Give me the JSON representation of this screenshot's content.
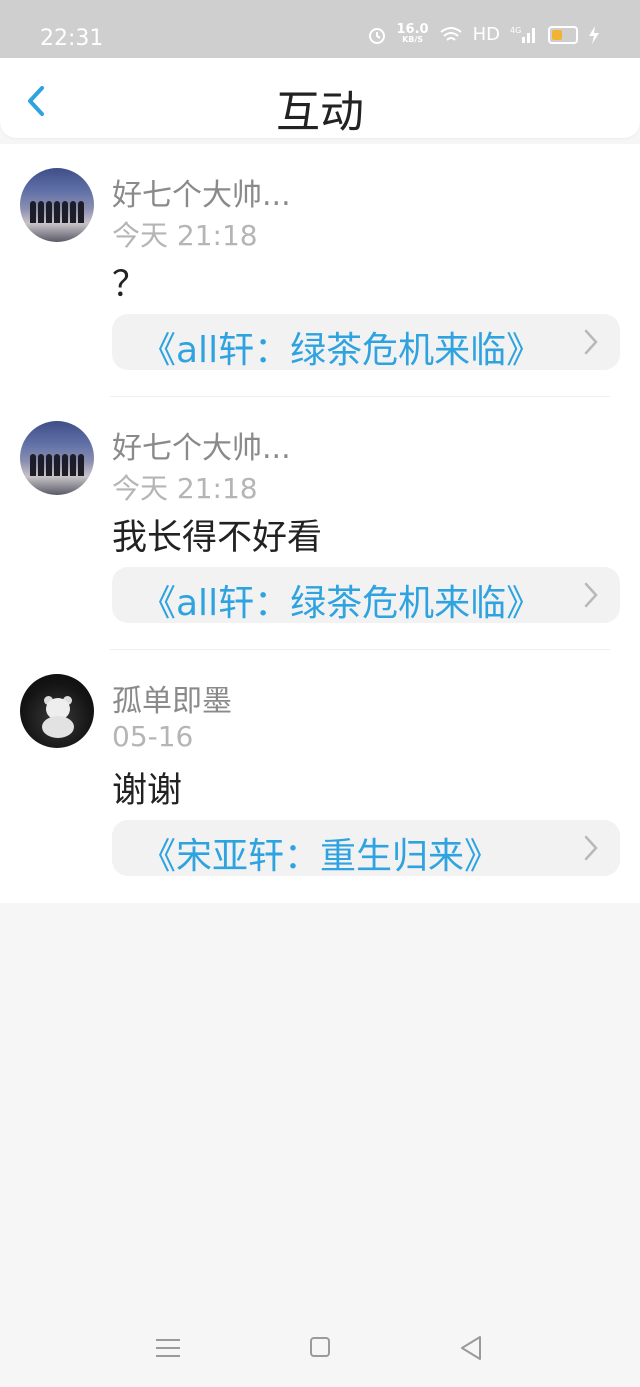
{
  "status_bar": {
    "time": "22:31",
    "net_speed": "16.0",
    "net_unit": "KB/S",
    "hd": "HD",
    "net_type": "4G"
  },
  "header": {
    "title": "互动"
  },
  "items": [
    {
      "name": "好七个大帅...",
      "time": "今天 21:18",
      "message": "？",
      "book": "《all轩：绿茶危机来临》"
    },
    {
      "name": "好七个大帅...",
      "time": "今天 21:18",
      "message": "我长得不好看",
      "book": "《all轩：绿茶危机来临》"
    },
    {
      "name": "孤单即墨",
      "time": "05-16",
      "message": "谢谢",
      "book": "《宋亚轩：重生归来》"
    }
  ],
  "colors": {
    "accent": "#2ea3e0",
    "battery": "#f2b233"
  },
  "icons": [
    "alarm-icon",
    "wifi-icon",
    "signal-icon",
    "battery-icon",
    "charging-icon",
    "back-icon",
    "chevron-right-icon",
    "menu-icon",
    "home-icon",
    "back-triangle-icon"
  ]
}
